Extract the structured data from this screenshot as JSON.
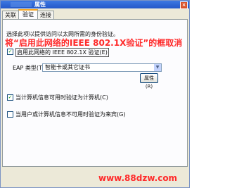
{
  "window": {
    "title": "属性",
    "close_glyph": "×"
  },
  "tabs": [
    {
      "label": "关联"
    },
    {
      "label": "验证"
    },
    {
      "label": "连接"
    }
  ],
  "auth": {
    "description": "选择此项以提供访问以太网所需的身份验证。",
    "annotation": "将“启用此网络的IEEE 802.1X验证”的框取消",
    "enable_8021x": {
      "label": "启用此网络的 IEEE 802.1X 验证(E)",
      "checked": true,
      "mark": "✓"
    },
    "eap_type_label": "EAP 类型(T):",
    "eap_type_value": "智能卡或其它证书",
    "properties_button": "属性(R)",
    "computer_auth": {
      "label": "当计算机信息可用时验证为计算机(C)",
      "checked": true,
      "mark": "✓"
    },
    "guest_auth": {
      "label": "当用户或计算机信息不可用时验证为来宾(G)",
      "checked": false,
      "mark": ""
    }
  },
  "watermark": "www.88dzw.com",
  "colors": {
    "annotation": "#ff2a2a",
    "titlebar": "#2458c8",
    "dialog_bg": "#ece9d8"
  }
}
